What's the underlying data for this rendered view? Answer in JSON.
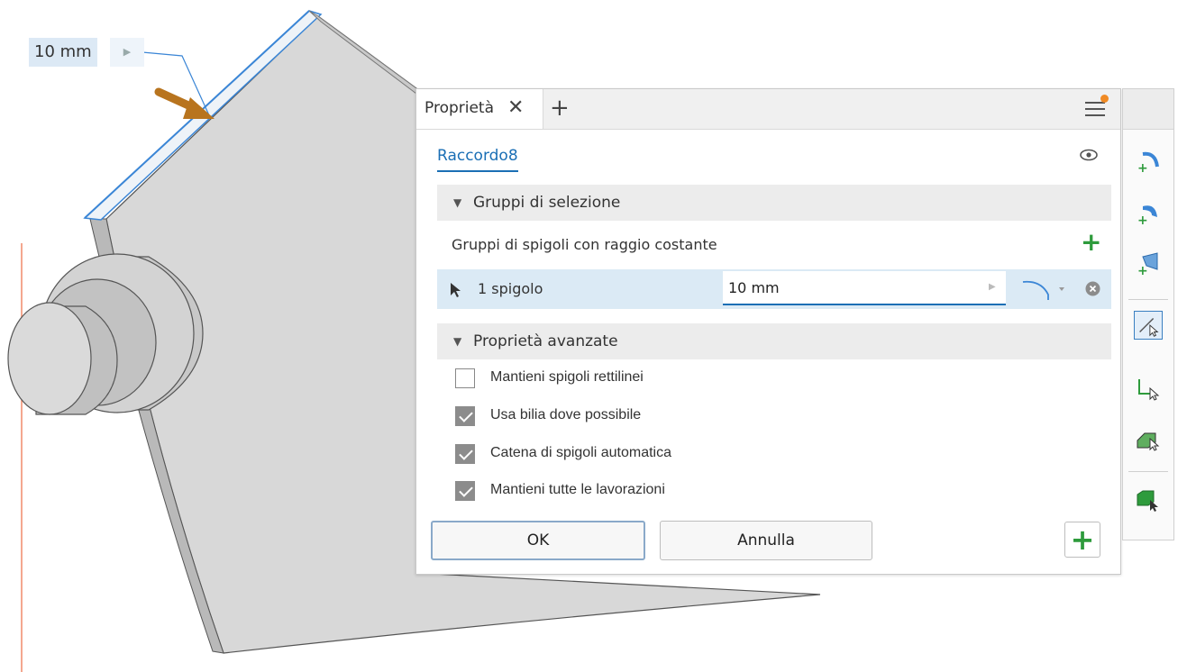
{
  "viewport": {
    "dimension_value": "10 mm"
  },
  "panel": {
    "tab_label": "Proprietà",
    "feature_name": "Raccordo8",
    "sections": {
      "selection": "Gruppi di selezione",
      "advanced": "Proprietà avanzate"
    },
    "edge_group_title": "Gruppi di spigoli con raggio costante",
    "edge_row": {
      "label": "1 spigolo",
      "value": "10 mm"
    },
    "options": [
      {
        "label": "Mantieni spigoli rettilinei",
        "checked": false
      },
      {
        "label": "Usa bilia dove possibile",
        "checked": true
      },
      {
        "label": "Catena di spigoli automatica",
        "checked": true
      },
      {
        "label": "Mantieni tutte le lavorazioni",
        "checked": true
      }
    ],
    "buttons": {
      "ok": "OK",
      "cancel": "Annulla"
    }
  },
  "colors": {
    "accent_blue": "#1b6fb5",
    "green_add": "#2e9b3c",
    "notification_dot": "#f08a24",
    "arrow": "#b8741e",
    "model_gray": "#d6d6d6"
  },
  "toolbar_icons": [
    "constant-fillet-icon",
    "variable-fillet-icon",
    "setback-fillet-icon",
    "edge-select-icon",
    "loop-select-icon",
    "feature-select-icon",
    "solid-select-icon"
  ]
}
